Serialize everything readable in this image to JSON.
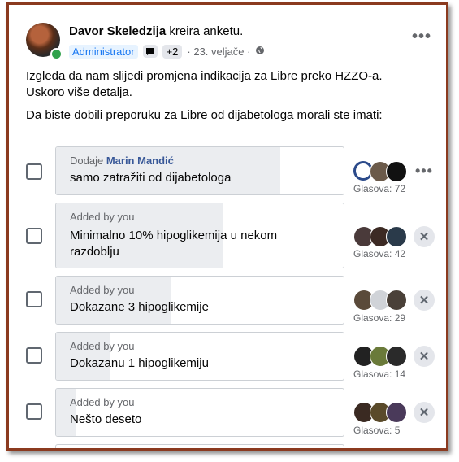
{
  "post": {
    "author": "Davor Skeledzija",
    "action": "kreira anketu.",
    "admin_badge": "Administrator",
    "plus_count": "+2",
    "date": "· 23. veljače ·",
    "privacy_icon": "globe-icon",
    "chat_icon": "chat-bubble-icon",
    "more_icon": "more-horizontal-icon",
    "more_label": "•••",
    "text_line1": "Izgleda da nam slijedi promjena indikacija za Libre preko HZZO-a.",
    "text_line2": "Uskoro više detalja.",
    "question": "Da biste dobili preporuku za Libre od dijabetologa morali ste imati:"
  },
  "poll": {
    "votes_prefix": "Glasova:",
    "remove_label": "✕",
    "options": [
      {
        "added_by_prefix": "Dodaje",
        "added_by": "Marin Mandić",
        "label": "samo zatražiti od dijabetologa",
        "votes": "Glasova: 72",
        "fraction": 0.78
      },
      {
        "added_by_prefix": "Added by you",
        "added_by": "",
        "label": "Minimalno 10% hipoglikemija u nekom",
        "label2": "razdoblju",
        "votes": "Glasova: 42",
        "fraction": 0.58
      },
      {
        "added_by_prefix": "Added by you",
        "added_by": "",
        "label": "Dokazane 3 hipoglikemije",
        "votes": "Glasova: 29",
        "fraction": 0.4
      },
      {
        "added_by_prefix": "Added by you",
        "added_by": "",
        "label": "Dokazanu 1 hipoglikemiju",
        "votes": "Glasova: 14",
        "fraction": 0.19
      },
      {
        "added_by_prefix": "Added by you",
        "added_by": "",
        "label": "Nešto deseto",
        "votes": "Glasova: 5",
        "fraction": 0.07
      }
    ]
  },
  "colors": {
    "accent": "#1877f2",
    "frame": "#8b3a1f",
    "fill": "#ebedf0"
  }
}
